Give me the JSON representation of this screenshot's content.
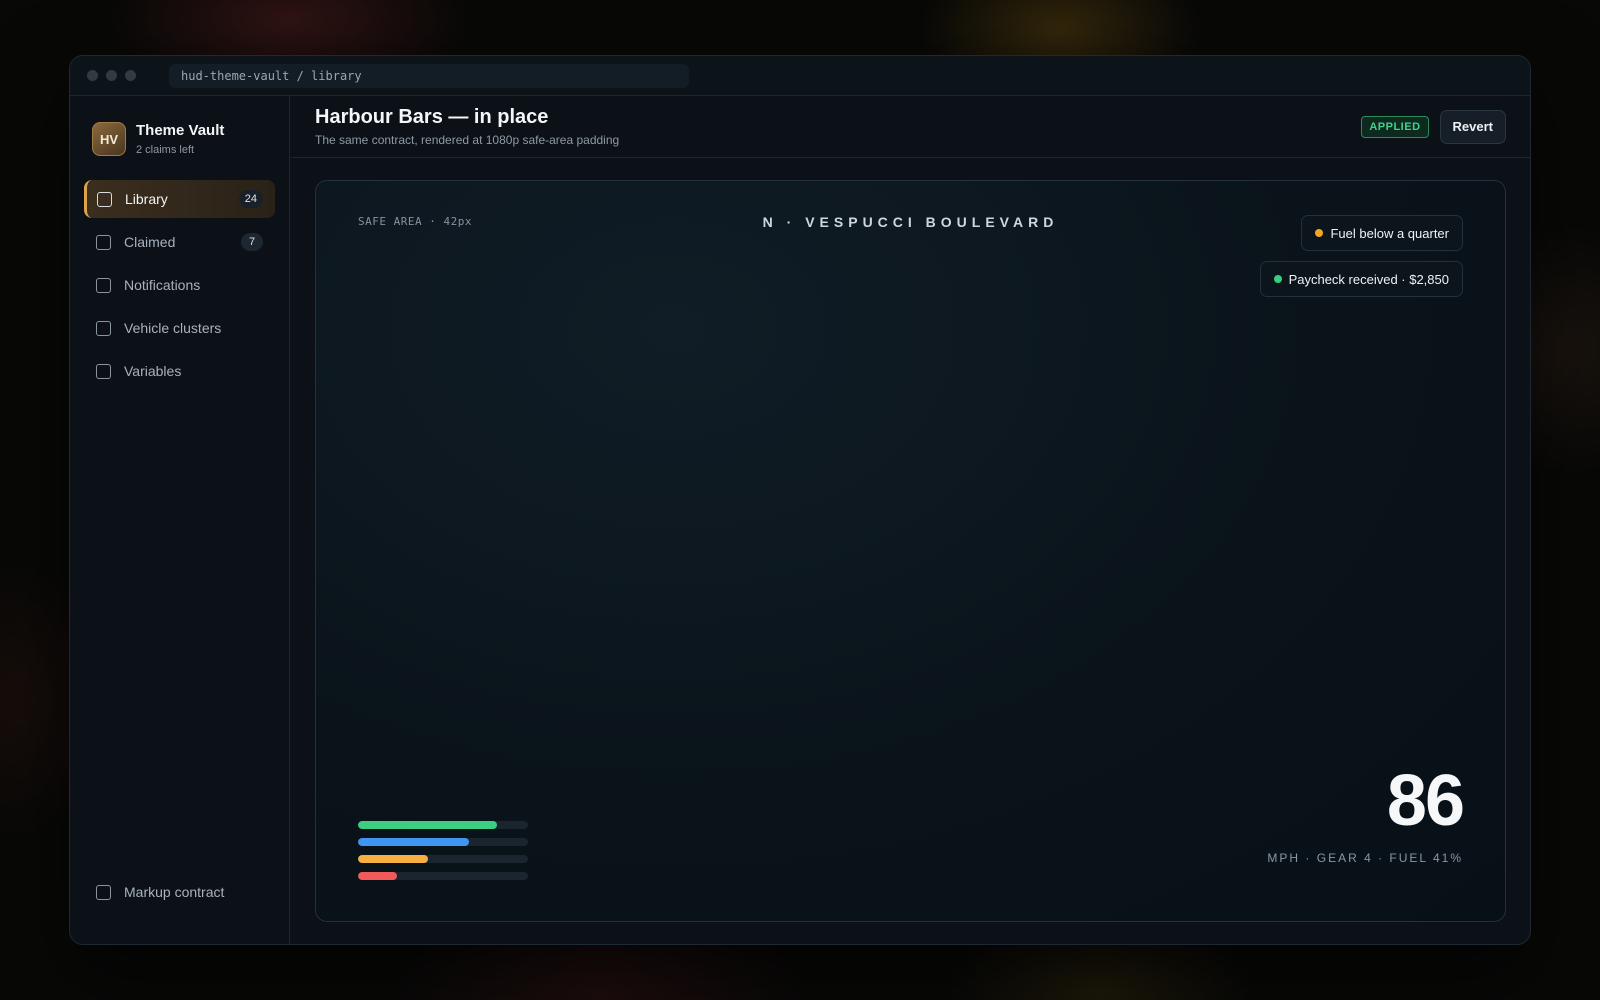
{
  "window": {
    "address": "hud-theme-vault / library"
  },
  "brand": {
    "initials": "HV",
    "name": "Theme Vault",
    "sub": "2 claims left"
  },
  "sidebar": {
    "items": [
      {
        "label": "Library",
        "count": "24",
        "active": true
      },
      {
        "label": "Claimed",
        "count": "7"
      },
      {
        "label": "Notifications"
      },
      {
        "label": "Vehicle clusters"
      },
      {
        "label": "Variables"
      }
    ],
    "footer": {
      "label": "Markup contract"
    }
  },
  "header": {
    "title": "Harbour Bars — in place",
    "subtitle": "The same contract, rendered at 1080p safe-area padding",
    "status": "APPLIED",
    "revert_label": "Revert"
  },
  "hud": {
    "safe_area": "SAFE AREA · 42px",
    "street": "N · VESPUCCI BOULEVARD",
    "toasts": [
      {
        "text": "Fuel below a quarter",
        "color": "#f5a524"
      },
      {
        "text": "Paycheck received · $2,850",
        "color": "#35d07f"
      }
    ],
    "bars": [
      {
        "name": "green",
        "level": 0.82,
        "color": "#3ccf84"
      },
      {
        "name": "blue",
        "level": 0.65,
        "color": "#3f96f0"
      },
      {
        "name": "amber",
        "level": 0.41,
        "color": "#f5b041"
      },
      {
        "name": "red",
        "level": 0.23,
        "color": "#f05a5a"
      }
    ],
    "speed": "86",
    "speed_meta": "MPH · GEAR 4 · FUEL 41%"
  }
}
